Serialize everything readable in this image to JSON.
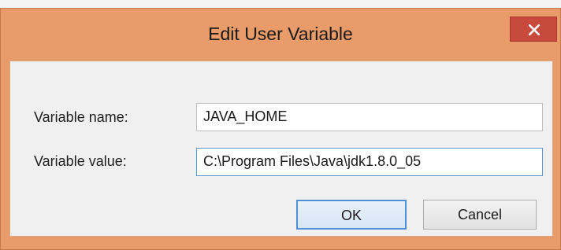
{
  "dialog": {
    "title": "Edit User Variable",
    "close_icon": "close-icon"
  },
  "fields": {
    "name_label": "Variable name:",
    "name_value": "JAVA_HOME",
    "value_label": "Variable value:",
    "value_value": "C:\\Program Files\\Java\\jdk1.8.0_05"
  },
  "buttons": {
    "ok_label": "OK",
    "cancel_label": "Cancel"
  },
  "colors": {
    "title_bar": "#e99b69",
    "close_button": "#c74a3d",
    "focus_border": "#5b9bd5"
  }
}
